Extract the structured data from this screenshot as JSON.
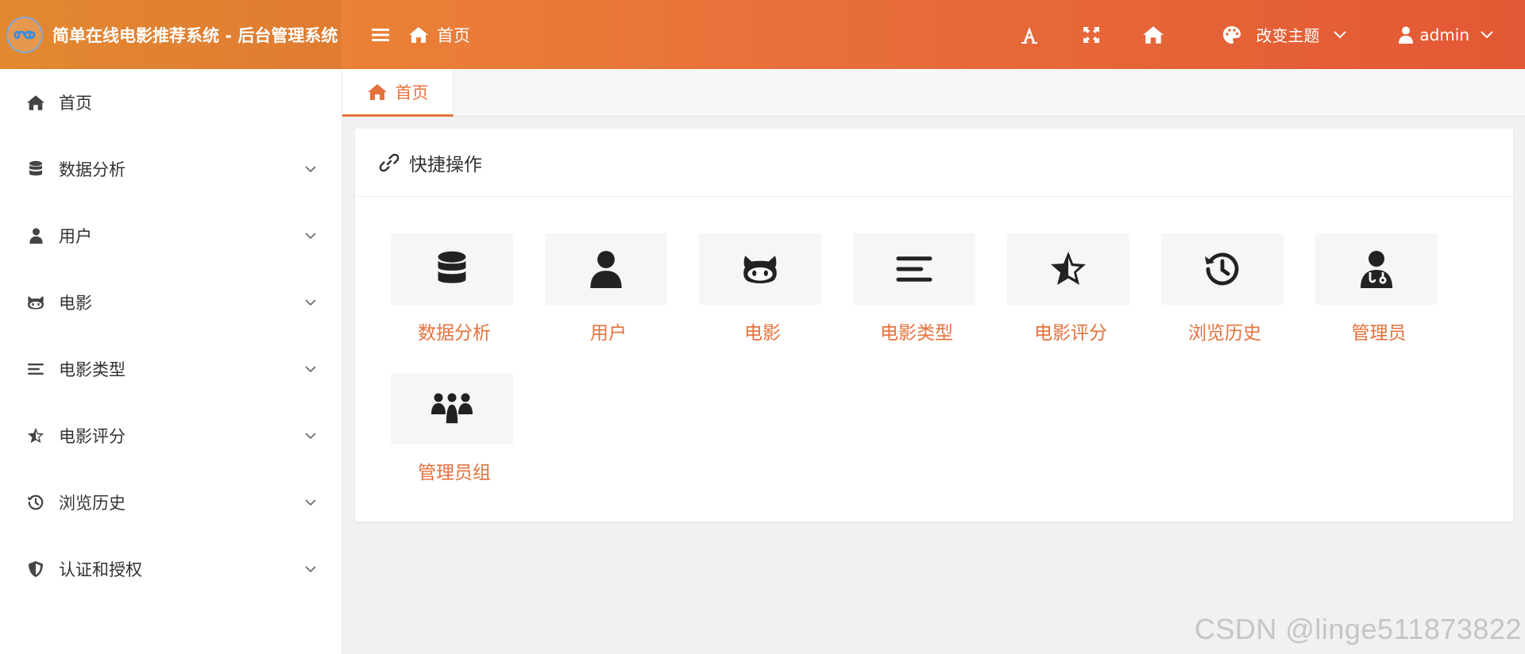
{
  "header": {
    "app_title": "简单在线电影推荐系统 - 后台管理系统",
    "breadcrumb": "首页",
    "theme_label": "改变主题",
    "user_label": "admin",
    "colors": {
      "gradient_start": "#ec8e32",
      "gradient_end": "#e35834"
    },
    "icons": [
      "logo-icon",
      "menu-icon",
      "home-icon",
      "font-icon",
      "fullscreen-icon",
      "home-icon",
      "palette-icon",
      "user-icon",
      "chevron-down-icon"
    ]
  },
  "sidebar": {
    "items": [
      {
        "label": "首页",
        "icon": "home-icon",
        "expandable": false
      },
      {
        "label": "数据分析",
        "icon": "database-icon",
        "expandable": true
      },
      {
        "label": "用户",
        "icon": "user-icon",
        "expandable": true
      },
      {
        "label": "电影",
        "icon": "cat-icon",
        "expandable": true
      },
      {
        "label": "电影类型",
        "icon": "list-icon",
        "expandable": true
      },
      {
        "label": "电影评分",
        "icon": "star-icon",
        "expandable": true
      },
      {
        "label": "浏览历史",
        "icon": "history-icon",
        "expandable": true
      },
      {
        "label": "认证和授权",
        "icon": "shield-icon",
        "expandable": true
      }
    ]
  },
  "tabs": [
    {
      "label": "首页",
      "icon": "home-icon",
      "active": true
    }
  ],
  "card": {
    "title": "快捷操作",
    "title_icon": "link-icon",
    "actions": [
      {
        "label": "数据分析",
        "icon": "database-icon"
      },
      {
        "label": "用户",
        "icon": "user-icon"
      },
      {
        "label": "电影",
        "icon": "cat-icon"
      },
      {
        "label": "电影类型",
        "icon": "list-icon"
      },
      {
        "label": "电影评分",
        "icon": "star-icon"
      },
      {
        "label": "浏览历史",
        "icon": "history-icon"
      },
      {
        "label": "管理员",
        "icon": "doctor-icon"
      },
      {
        "label": "管理员组",
        "icon": "group-icon"
      }
    ]
  },
  "accent_color": "#e5713c",
  "watermark": "CSDN @linge511873822"
}
